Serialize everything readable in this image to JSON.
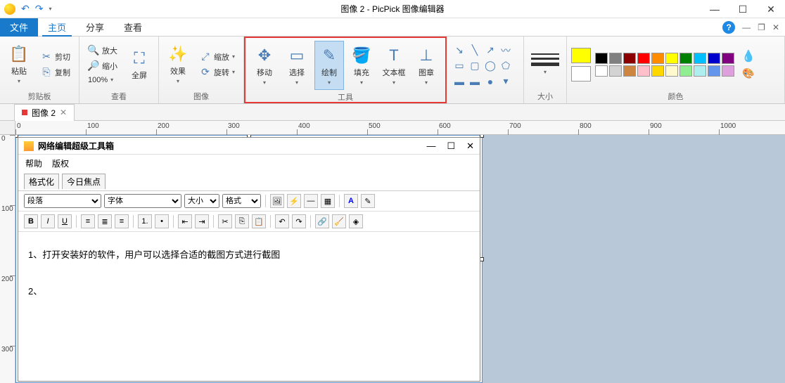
{
  "titlebar": {
    "title": "图像 2 - PicPick 图像编辑器"
  },
  "tabs": {
    "file": "文件",
    "home": "主页",
    "share": "分享",
    "view": "查看"
  },
  "ribbon": {
    "clipboard": {
      "label": "剪贴板",
      "paste": "粘贴",
      "cut": "剪切",
      "copy": "复制"
    },
    "viewgroup": {
      "label": "查看",
      "zoomin": "放大",
      "zoomout": "缩小",
      "zoom100": "100%",
      "fullscreen": "全屏"
    },
    "image": {
      "label": "图像",
      "effects": "效果",
      "resize": "缩放",
      "rotate": "旋转"
    },
    "tools": {
      "label": "工具",
      "move": "移动",
      "select": "选择",
      "draw": "绘制",
      "fill": "填充",
      "text": "文本框",
      "stamp": "图章"
    },
    "size": {
      "label": "大小"
    },
    "colors": {
      "label": "颜色"
    }
  },
  "doctab": {
    "name": "图像 2"
  },
  "ruler": {
    "hticks": [
      "0",
      "100",
      "200",
      "300",
      "400",
      "500",
      "600",
      "700",
      "800",
      "900",
      "1000"
    ],
    "vticks": [
      "0",
      "100",
      "200",
      "300"
    ]
  },
  "editor": {
    "title": "网络编辑超级工具箱",
    "menu_help": "帮助",
    "menu_copyright": "版权",
    "tab_format": "格式化",
    "tab_today": "今日焦点",
    "dd_paragraph": "段落",
    "dd_font": "字体",
    "dd_size": "大小",
    "dd_style": "格式",
    "content_line1": "1、打开安装好的软件，用户可以选择合适的截图方式进行截图",
    "content_line2": "2、"
  },
  "swatches_row1": [
    "#000000",
    "#808080",
    "#8b0000",
    "#ff0000",
    "#ff8c00",
    "#ffff00",
    "#008000",
    "#00bfff",
    "#0000cd",
    "#800080"
  ],
  "swatches_row2": [
    "#ffffff",
    "#d3d3d3",
    "#cd853f",
    "#ffc0cb",
    "#ffd700",
    "#fffacd",
    "#90ee90",
    "#afeeee",
    "#6495ed",
    "#dda0dd"
  ],
  "current_color1": "#ffff00",
  "current_color2": "#ffffff"
}
